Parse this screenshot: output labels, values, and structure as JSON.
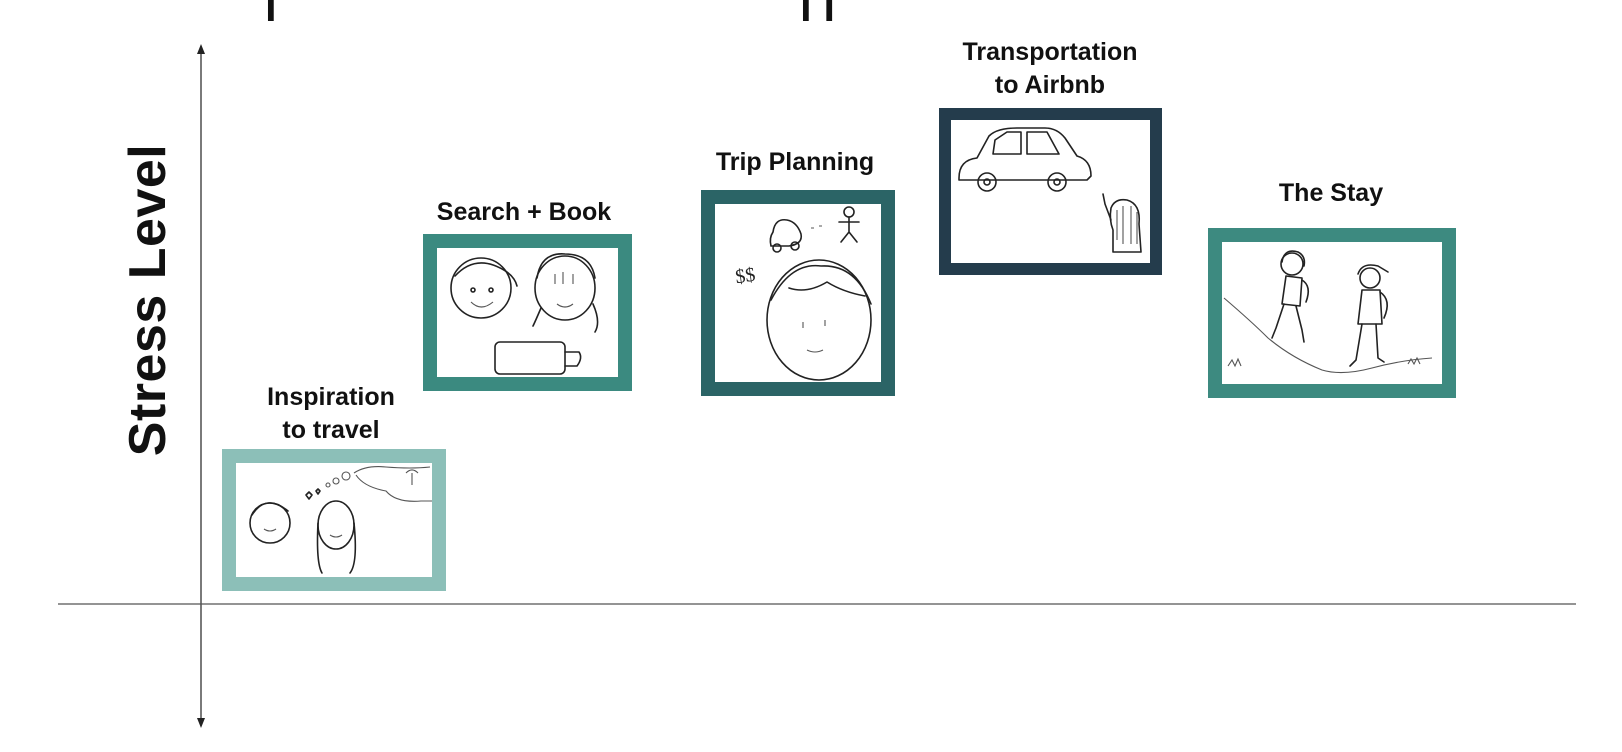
{
  "diagram": {
    "y_axis_label": "Stress Level",
    "stages": [
      {
        "title_line1": "Inspiration",
        "title_line2": "to travel",
        "frame_color": "#8cbfb8",
        "sketch_icon": "friends-dreaming-of-beach-icon"
      },
      {
        "title_line1": "Search + Book",
        "title_line2": "",
        "frame_color": "#3b8a80",
        "sketch_icon": "friends-with-laptop-icon"
      },
      {
        "title_line1": "Trip Planning",
        "title_line2": "",
        "frame_color": "#2b6466",
        "sketch_icon": "person-planning-costs-icon"
      },
      {
        "title_line1": "Transportation",
        "title_line2": "to Airbnb",
        "frame_color": "#243c4c",
        "sketch_icon": "car-and-traveler-icon"
      },
      {
        "title_line1": "The Stay",
        "title_line2": "",
        "frame_color": "#3d8a80",
        "sketch_icon": "friends-hiking-icon"
      }
    ]
  }
}
